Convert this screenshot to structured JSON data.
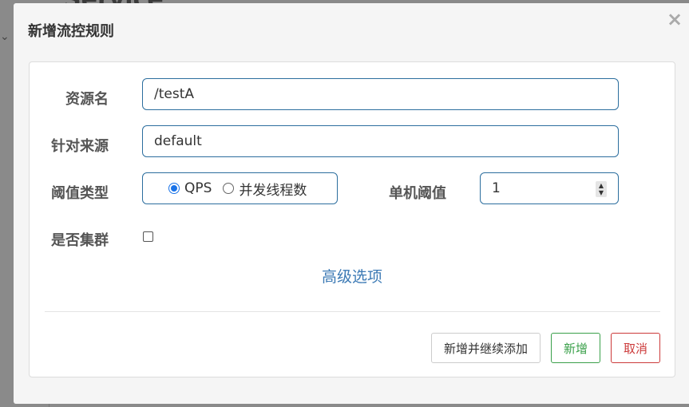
{
  "dialog": {
    "title": "新增流控规则",
    "close_glyph": "×"
  },
  "form": {
    "resource": {
      "label": "资源名",
      "value": "/testA"
    },
    "source": {
      "label": "针对来源",
      "value": "default"
    },
    "threshold_type": {
      "label": "阈值类型",
      "options": [
        {
          "label": "QPS",
          "checked": true
        },
        {
          "label": "并发线程数",
          "checked": false
        }
      ]
    },
    "single_threshold": {
      "label": "单机阈值",
      "value": "1"
    },
    "cluster": {
      "label": "是否集群",
      "checked": false
    },
    "advanced_link": "高级选项"
  },
  "buttons": {
    "continue_label": "新增并继续添加",
    "add_label": "新增",
    "cancel_label": "取消"
  },
  "colors": {
    "input_border": "#2c6e9e",
    "link": "#3c7ab5",
    "success": "#3aa04a",
    "danger": "#cc3a3a"
  }
}
